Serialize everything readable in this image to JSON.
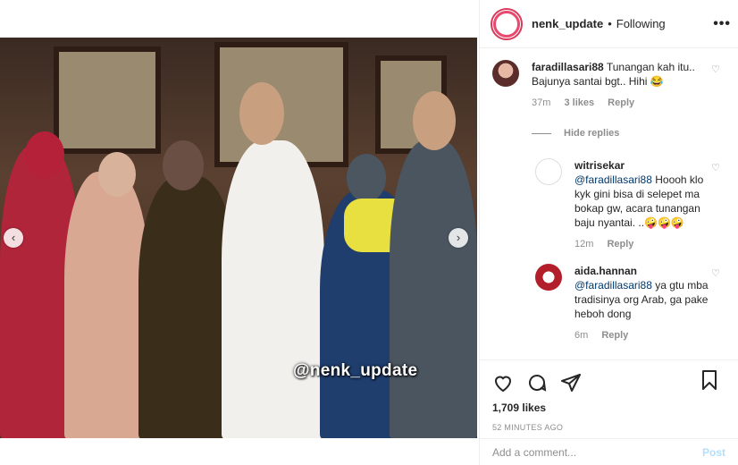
{
  "media": {
    "watermark": "@nenk_update",
    "nav_left": "‹",
    "nav_right": "›"
  },
  "header": {
    "username": "nenk_update",
    "separator": "•",
    "follow_status": "Following",
    "more": "•••"
  },
  "comments": [
    {
      "user": "faradillasari88",
      "text": "Tunangan kah itu.. Bajunya santai bgt.. Hihi 😂",
      "time": "37m",
      "likes": "3 likes",
      "reply": "Reply"
    }
  ],
  "hide_replies": "Hide replies",
  "replies": [
    {
      "user": "witrisekar",
      "mention": "@faradillasari88",
      "text": " Hoooh klo kyk gini bisa di selepet ma bokap gw, acara tunangan baju nyantai. ..🤪🤪🤪",
      "time": "12m",
      "reply": "Reply"
    },
    {
      "user": "aida.hannan",
      "mention": "@faradillasari88",
      "text": " ya gtu mba tradisinya org Arab, ga pake heboh dong",
      "time": "6m",
      "reply": "Reply"
    }
  ],
  "actions": {
    "likes": "1,709 likes",
    "time_ago": "52 MINUTES AGO"
  },
  "add_comment": {
    "placeholder": "Add a comment...",
    "post": "Post"
  },
  "colors": {
    "link": "#00376b",
    "muted": "#8e8e8e",
    "post_disabled": "#b2dffc",
    "avatar_ring": "#d93a5c"
  }
}
